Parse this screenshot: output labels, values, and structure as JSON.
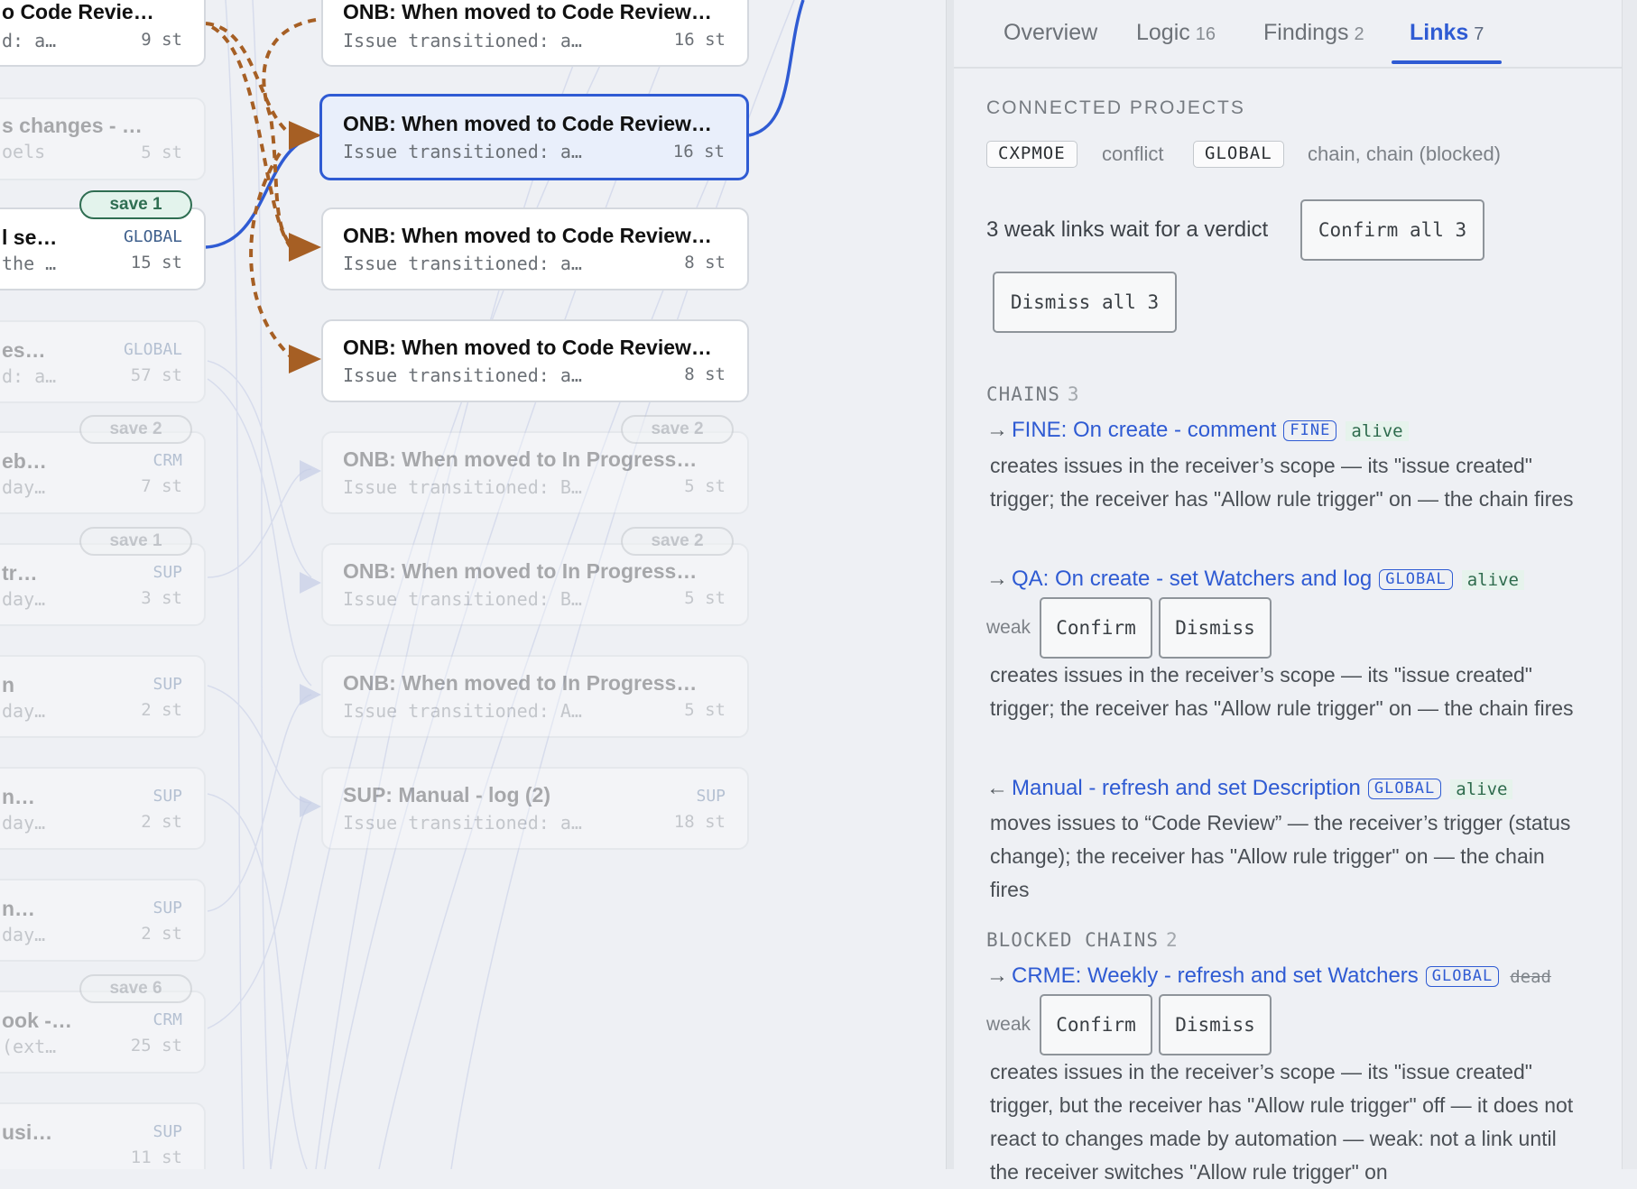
{
  "canvas": {
    "left_nodes": [
      {
        "title": "o Code Revie…",
        "sub": "d: a…",
        "scope": "",
        "steps": "9 st"
      },
      {
        "title": "s changes - …",
        "sub": "oels",
        "scope": "",
        "steps": "5 st"
      },
      {
        "title": "l se…",
        "sub": "the …",
        "scope": "GLOBAL",
        "steps": "15 st"
      },
      {
        "title": "es…",
        "sub": "d: a…",
        "scope": "GLOBAL",
        "steps": "57 st"
      },
      {
        "title": "eb…",
        "sub": "day…",
        "scope": "CRM",
        "steps": "7 st"
      },
      {
        "title": "tr…",
        "sub": "day…",
        "scope": "SUP",
        "steps": "3 st"
      },
      {
        "title": "n",
        "sub": "day…",
        "scope": "SUP",
        "steps": "2 st"
      },
      {
        "title": "n…",
        "sub": "day…",
        "scope": "SUP",
        "steps": "2 st"
      },
      {
        "title": "n…",
        "sub": "day…",
        "scope": "SUP",
        "steps": "2 st"
      },
      {
        "title": "ook -…",
        "sub": "(ext…",
        "scope": "CRM",
        "steps": "25 st"
      },
      {
        "title": "usi…",
        "sub": "",
        "scope": "SUP",
        "steps": "11 st"
      }
    ],
    "right_nodes": [
      {
        "title": "ONB: When moved to Code Review…",
        "sub": "Issue transitioned: a…",
        "scope": "",
        "steps": "16 st"
      },
      {
        "title": "ONB: When moved to Code Review…",
        "sub": "Issue transitioned: a…",
        "scope": "",
        "steps": "16 st"
      },
      {
        "title": "ONB: When moved to Code Review…",
        "sub": "Issue transitioned: a…",
        "scope": "",
        "steps": "8 st"
      },
      {
        "title": "ONB: When moved to Code Review…",
        "sub": "Issue transitioned: a…",
        "scope": "",
        "steps": "8 st"
      },
      {
        "title": "ONB: When moved to In Progress…",
        "sub": "Issue transitioned: B…",
        "scope": "",
        "steps": "5 st"
      },
      {
        "title": "ONB: When moved to In Progress…",
        "sub": "Issue transitioned: B…",
        "scope": "",
        "steps": "5 st"
      },
      {
        "title": "ONB: When moved to In Progress…",
        "sub": "Issue transitioned: A…",
        "scope": "",
        "steps": "5 st"
      },
      {
        "title": "SUP: Manual - log (2)",
        "sub": "Issue transitioned: a…",
        "scope": "SUP",
        "steps": "18 st"
      }
    ],
    "pills": [
      "save 1",
      "save 2",
      "save 1",
      "save 6",
      "save 2",
      "save 2"
    ]
  },
  "tabs": [
    {
      "label": "Overview",
      "count": ""
    },
    {
      "label": "Logic",
      "count": "16"
    },
    {
      "label": "Findings",
      "count": "2"
    },
    {
      "label": "Links",
      "count": "7"
    }
  ],
  "connected": {
    "heading": "CONNECTED PROJECTS",
    "items": [
      {
        "project": "CXPMOE",
        "relation": "conflict"
      },
      {
        "project": "GLOBAL",
        "relation": "chain, chain (blocked)"
      }
    ]
  },
  "weak_verdict": {
    "text": "3 weak links wait for a verdict",
    "confirm_all": "Confirm all 3",
    "dismiss_all": "Dismiss all 3"
  },
  "chains": {
    "heading": "CHAINS",
    "count": "3",
    "items": [
      {
        "arrow": "→",
        "name": "FINE: On create - comment",
        "scope": "FINE",
        "state": "alive",
        "weak_label": "",
        "desc": "creates issues in the receiver’s scope — its \"issue created\" trigger; the receiver has \"Allow rule trigger\" on — the chain fires"
      },
      {
        "arrow": "→",
        "name": "QA: On create - set Watchers and log",
        "scope": "GLOBAL",
        "state": "alive",
        "weak_label": "weak",
        "confirm": "Confirm",
        "dismiss": "Dismiss",
        "desc": "creates issues in the receiver’s scope — its \"issue created\" trigger; the receiver has \"Allow rule trigger\" on — the chain fires"
      },
      {
        "arrow": "←",
        "name": "Manual - refresh and set Description",
        "scope": "GLOBAL",
        "state": "alive",
        "weak_label": "",
        "desc": "moves issues to “Code Review” — the receiver’s trigger (status change); the receiver has \"Allow rule trigger\" on — the chain fires"
      }
    ]
  },
  "blocked": {
    "heading": "BLOCKED CHAINS",
    "count": "2",
    "items": [
      {
        "arrow": "→",
        "name": "CRME: Weekly - refresh and set Watchers",
        "scope": "GLOBAL",
        "state": "dead",
        "weak_label": "weak",
        "confirm": "Confirm",
        "dismiss": "Dismiss",
        "desc": "creates issues in the receiver’s scope — its \"issue created\" trigger, but the receiver has \"Allow rule trigger\" off — it does not react to changes made by automation — weak: not a link until the receiver switches \"Allow rule trigger\" on"
      }
    ]
  },
  "colors": {
    "accent": "#2f5bd3",
    "chain_edge": "#a65f24",
    "alive_bg": "#e6f3ec",
    "alive_fg": "#2e6b4d"
  }
}
